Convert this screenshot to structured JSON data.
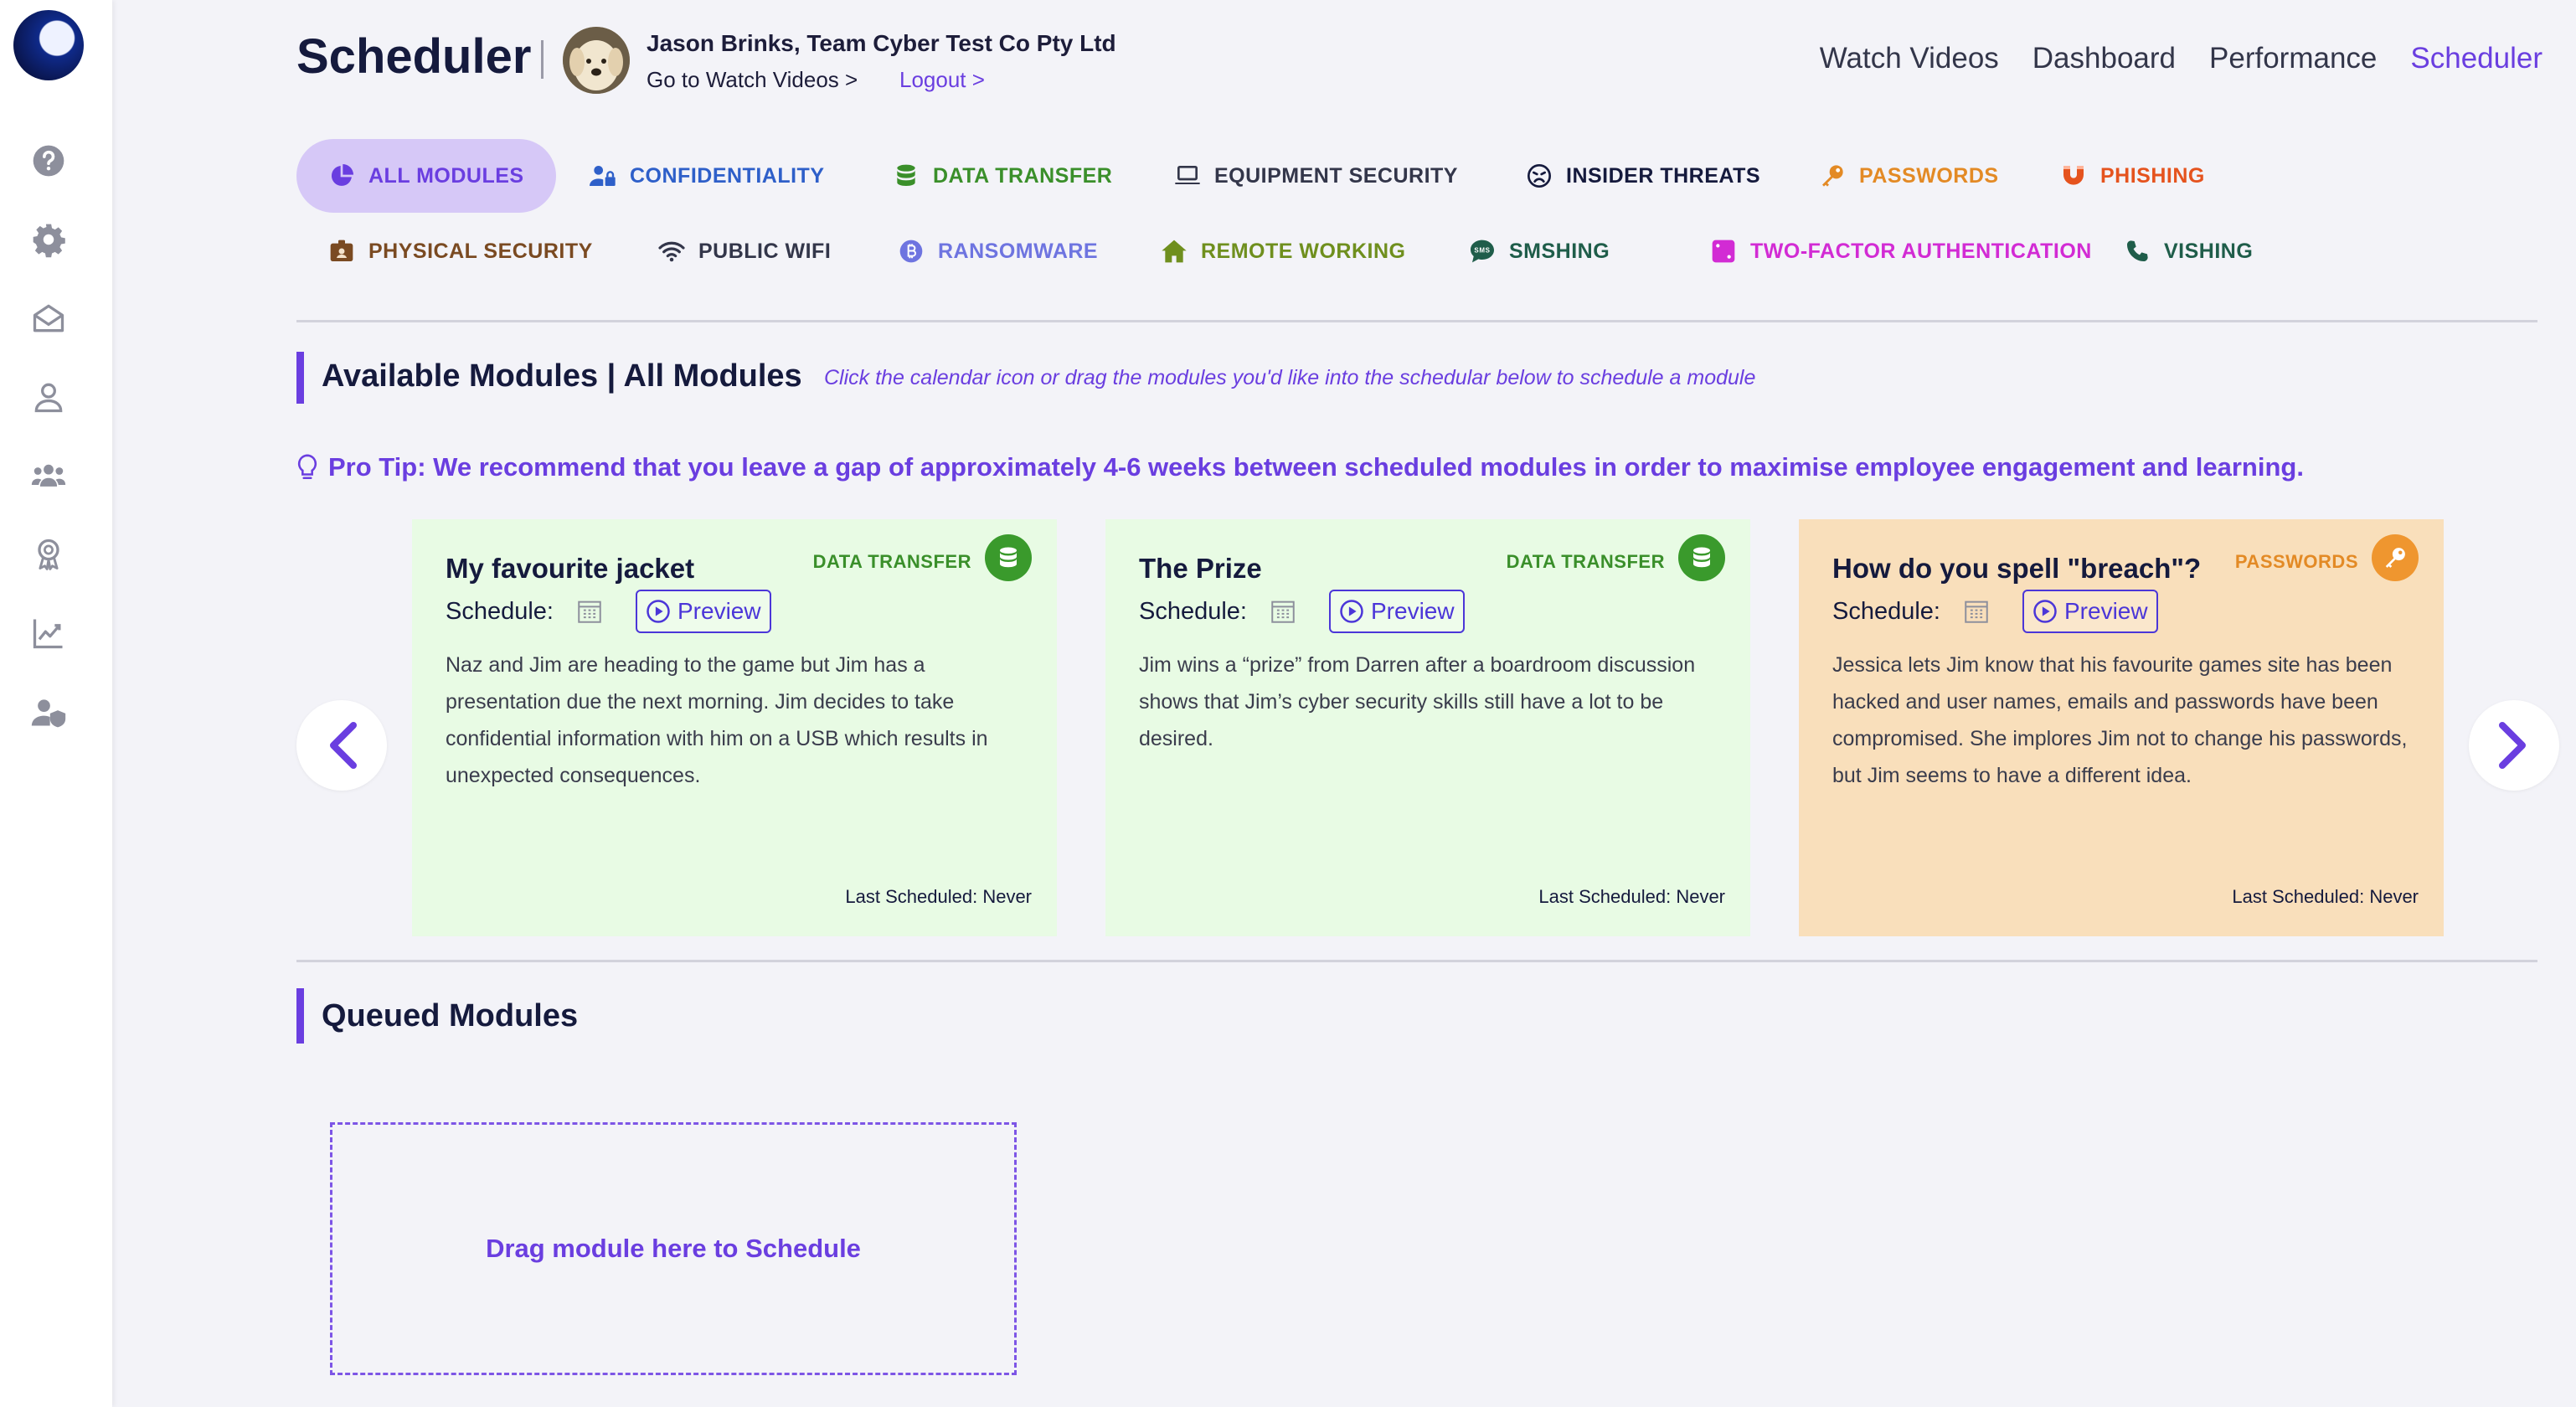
{
  "header": {
    "title": "Scheduler",
    "user_name": "Jason Brinks, Team Cyber Test Co Pty Ltd",
    "go_to_watch": "Go to Watch Videos >",
    "logout": "Logout >"
  },
  "topnav": [
    {
      "label": "Watch Videos",
      "active": false
    },
    {
      "label": "Dashboard",
      "active": false
    },
    {
      "label": "Performance",
      "active": false
    },
    {
      "label": "Scheduler",
      "active": true
    }
  ],
  "sidebar": {
    "icons": [
      "help-icon",
      "gear-icon",
      "mail-open-icon",
      "user-icon",
      "group-icon",
      "award-icon",
      "chart-icon",
      "user-shield-icon"
    ]
  },
  "tabs": [
    {
      "label": "ALL MODULES",
      "color": "#6a3ee0",
      "icon": "pie-chart-icon",
      "selected": true
    },
    {
      "label": "CONFIDENTIALITY",
      "color": "#2e5fc9",
      "icon": "user-lock-icon"
    },
    {
      "label": "DATA TRANSFER",
      "color": "#3a8f2a",
      "icon": "database-icon"
    },
    {
      "label": "EQUIPMENT SECURITY",
      "color": "#33364a",
      "icon": "laptop-icon"
    },
    {
      "label": "INSIDER THREATS",
      "color": "#151a3d",
      "icon": "angry-face-icon"
    },
    {
      "label": "PASSWORDS",
      "color": "#e38a25",
      "icon": "key-icon"
    },
    {
      "label": "PHISHING",
      "color": "#e5531e",
      "icon": "magnet-icon"
    },
    {
      "label": "PHYSICAL SECURITY",
      "color": "#7a4a22",
      "icon": "id-badge-icon"
    },
    {
      "label": "PUBLIC WIFI",
      "color": "#33364a",
      "icon": "wifi-icon"
    },
    {
      "label": "RANSOMWARE",
      "color": "#6e74e0",
      "icon": "bitcoin-icon"
    },
    {
      "label": "REMOTE WORKING",
      "color": "#6f8f1e",
      "icon": "house-icon"
    },
    {
      "label": "SMSHING",
      "color": "#1f5d4a",
      "icon": "sms-icon"
    },
    {
      "label": "TWO-FACTOR AUTHENTICATION",
      "color": "#d22bd4",
      "icon": "dice-icon"
    },
    {
      "label": "VISHING",
      "color": "#1f5d4a",
      "icon": "phone-icon"
    }
  ],
  "available": {
    "title": "Available Modules | All Modules",
    "hint": "Click the calendar icon or drag the modules you'd like into the schedular below to schedule a module",
    "pro_tip": "Pro Tip: We recommend that you leave a gap of approximately 4-6 weeks between scheduled modules in order to maximise employee engagement and learning."
  },
  "cards": [
    {
      "title": "My favourite jacket",
      "tag": "DATA TRANSFER",
      "tag_color": "#3a8f2a",
      "bg": "#e8fbe4",
      "icon": "database-icon",
      "schedule_label": "Schedule:",
      "preview_label": "Preview",
      "description": "Naz and Jim are heading to the game but Jim has a presentation due the next morning. Jim decides to take confidential information with him on a USB which results in unexpected consequences.",
      "last_scheduled": "Last Scheduled: Never"
    },
    {
      "title": "The Prize",
      "tag": "DATA TRANSFER",
      "tag_color": "#3a8f2a",
      "bg": "#e8fbe4",
      "icon": "database-icon",
      "schedule_label": "Schedule:",
      "preview_label": "Preview",
      "description": "Jim wins a “prize” from Darren after a boardroom discussion shows that Jim’s cyber security skills still have a lot to be desired.",
      "last_scheduled": "Last Scheduled: Never"
    },
    {
      "title": "How do you spell \"breach\"?",
      "tag": "PASSWORDS",
      "tag_color": "#e38a25",
      "bg": "#f9dfbb",
      "icon": "key-icon",
      "schedule_label": "Schedule:",
      "preview_label": "Preview",
      "description": "Jessica lets Jim know that his favourite games site has been hacked and user names, emails and passwords have been compromised. She implores Jim not to change his passwords, but Jim seems to have a different idea.",
      "last_scheduled": "Last Scheduled: Never"
    }
  ],
  "queued": {
    "title": "Queued Modules",
    "dropzone": "Drag module here to Schedule"
  },
  "colors": {
    "accent": "#6a3ee0",
    "selected_tab_bg": "#d6c8f7"
  }
}
